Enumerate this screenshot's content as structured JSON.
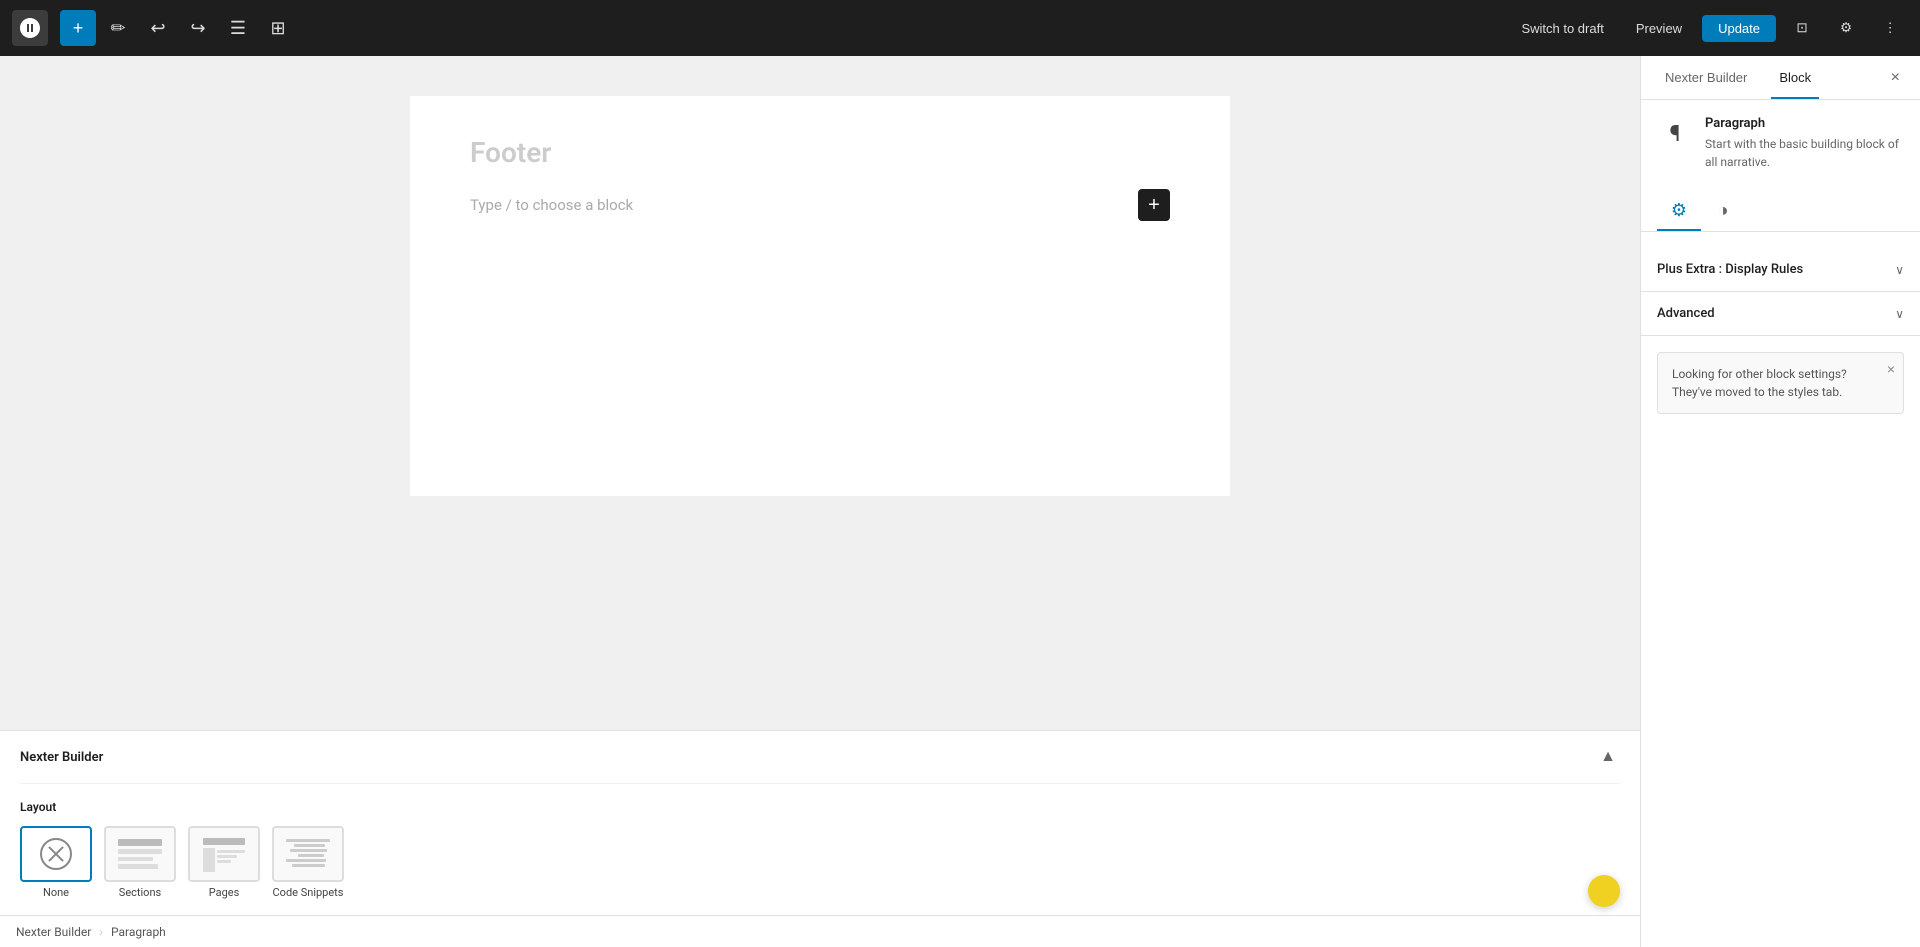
{
  "toolbar": {
    "switch_to_draft": "Switch to draft",
    "preview": "Preview",
    "update": "Update"
  },
  "editor": {
    "page_title": "Footer",
    "block_placeholder": "Type / to choose a block"
  },
  "sidebar": {
    "tab_nexter_builder": "Nexter Builder",
    "tab_block": "Block",
    "block_name": "Paragraph",
    "block_description": "Start with the basic building block of all narrative.",
    "accordion": {
      "display_rules": "Plus Extra : Display Rules",
      "advanced": "Advanced"
    },
    "notice": {
      "text": "Looking for other block settings? They've moved to the styles tab."
    }
  },
  "bottom_panel": {
    "title": "Nexter Builder",
    "layout_label": "Layout",
    "options": [
      {
        "label": "None",
        "type": "none",
        "active": true
      },
      {
        "label": "Sections",
        "type": "sections",
        "active": false
      },
      {
        "label": "Pages",
        "type": "pages",
        "active": false
      },
      {
        "label": "Code Snippets",
        "type": "code-snippets",
        "active": false
      }
    ]
  },
  "status_bar": {
    "left": "Nexter Builder",
    "separator": "›",
    "right": "Paragraph"
  },
  "icons": {
    "gear": "⚙",
    "contrast": "◑",
    "chevron_down": "∨",
    "chevron_up": "∧",
    "close": "×",
    "minus": "–",
    "plus": "+"
  }
}
